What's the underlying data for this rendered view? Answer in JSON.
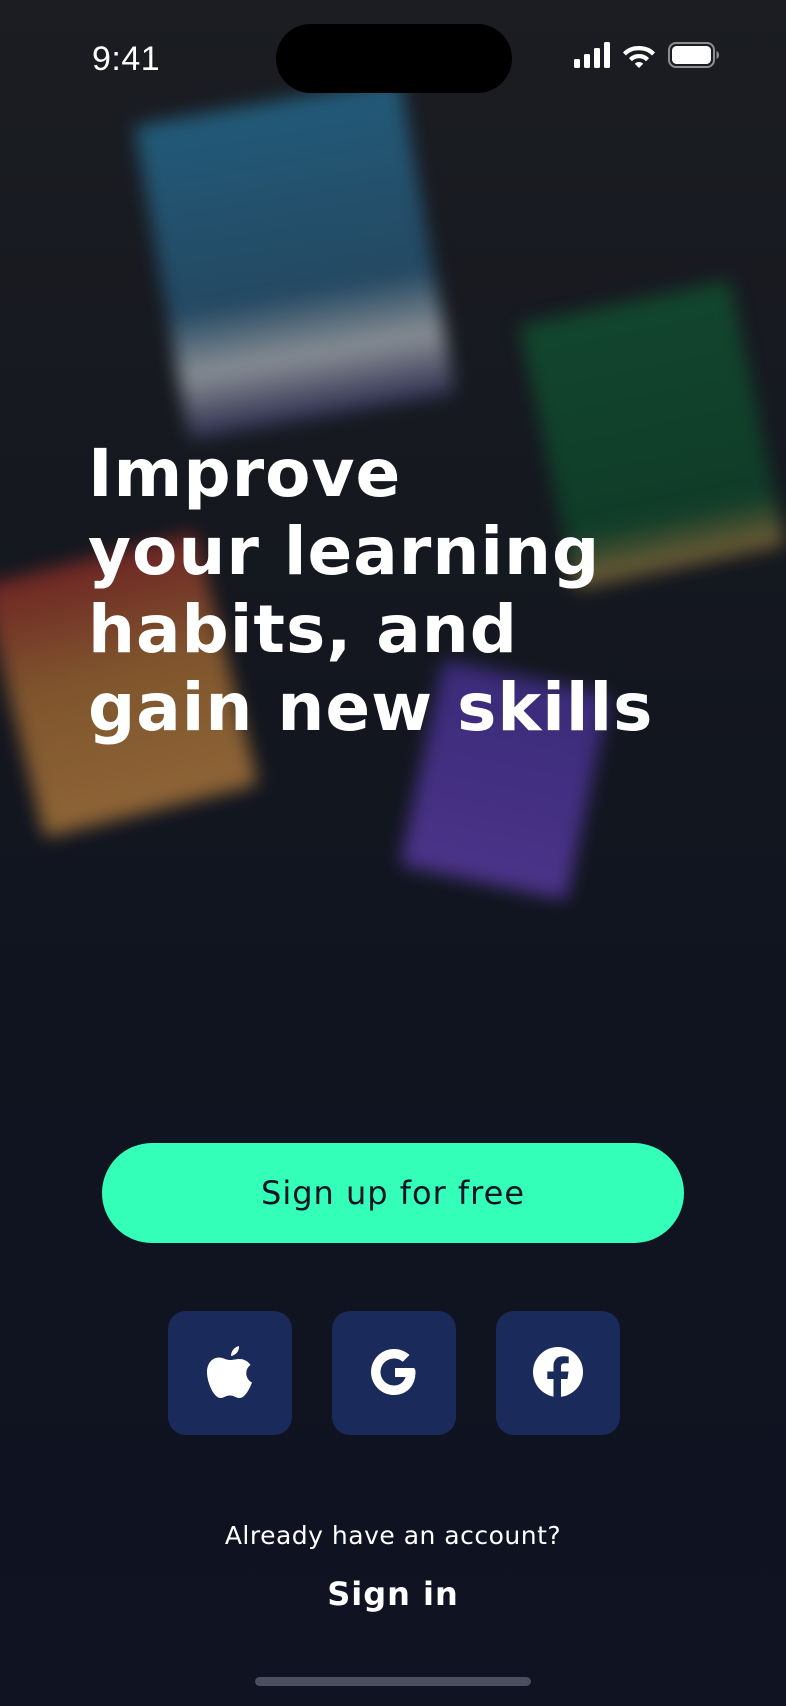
{
  "status_bar": {
    "time": "9:41",
    "icons": [
      "cellular-signal-icon",
      "wifi-icon",
      "battery-icon"
    ]
  },
  "headline": {
    "lines": [
      "Improve",
      "your learning",
      "habits, and",
      "gain new skills"
    ]
  },
  "signup": {
    "label": "Sign up for free",
    "color": "#33ffb8"
  },
  "social": {
    "buttons": [
      {
        "name": "apple",
        "icon": "apple-icon"
      },
      {
        "name": "google",
        "icon": "google-icon"
      },
      {
        "name": "facebook",
        "icon": "facebook-icon"
      }
    ],
    "button_color": "#1a2a5a"
  },
  "signin": {
    "prompt": "Already have an account?",
    "label": "Sign in"
  },
  "colors": {
    "background": "#10141f",
    "accent": "#33ffb8",
    "text": "#ffffff"
  }
}
